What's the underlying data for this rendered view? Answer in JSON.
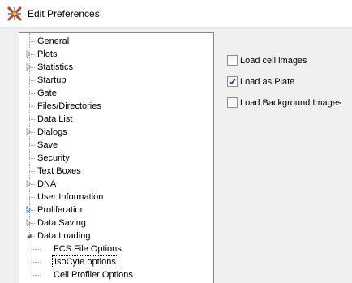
{
  "window": {
    "title": "Edit Preferences",
    "icon": "app-x-logo-icon"
  },
  "tree": {
    "items": [
      {
        "label": "General",
        "expander": "none",
        "level": 0
      },
      {
        "label": "Plots",
        "expander": "collapsed",
        "level": 0
      },
      {
        "label": "Statistics",
        "expander": "collapsed",
        "level": 0
      },
      {
        "label": "Startup",
        "expander": "none",
        "level": 0
      },
      {
        "label": "Gate",
        "expander": "none",
        "level": 0
      },
      {
        "label": "Files/Directories",
        "expander": "none",
        "level": 0
      },
      {
        "label": "Data List",
        "expander": "none",
        "level": 0
      },
      {
        "label": "Dialogs",
        "expander": "collapsed",
        "level": 0
      },
      {
        "label": "Save",
        "expander": "none",
        "level": 0
      },
      {
        "label": "Security",
        "expander": "none",
        "level": 0
      },
      {
        "label": "Text Boxes",
        "expander": "none",
        "level": 0
      },
      {
        "label": "DNA",
        "expander": "collapsed",
        "level": 0
      },
      {
        "label": "User Information",
        "expander": "none",
        "level": 0
      },
      {
        "label": "Proliferation",
        "expander": "collapsed-hover",
        "level": 0
      },
      {
        "label": "Data Saving",
        "expander": "collapsed",
        "level": 0
      },
      {
        "label": "Data Loading",
        "expander": "expanded",
        "level": 0
      },
      {
        "label": "FCS File Options",
        "expander": "none",
        "level": 1
      },
      {
        "label": "IsoCyte options",
        "expander": "none",
        "level": 1,
        "selected": true
      },
      {
        "label": "Cell Profiler Options",
        "expander": "none",
        "level": 1
      }
    ]
  },
  "options": {
    "load_cell_images": {
      "label": "Load cell images",
      "checked": false
    },
    "load_as_plate": {
      "label": "Load as Plate",
      "checked": true
    },
    "load_background_images": {
      "label": "Load Background Images",
      "checked": false
    }
  },
  "colors": {
    "hover_expander": "#26a0da",
    "expander": "#a6a6a6",
    "tree_border": "#828790",
    "check_mark": "#3b4a78"
  }
}
